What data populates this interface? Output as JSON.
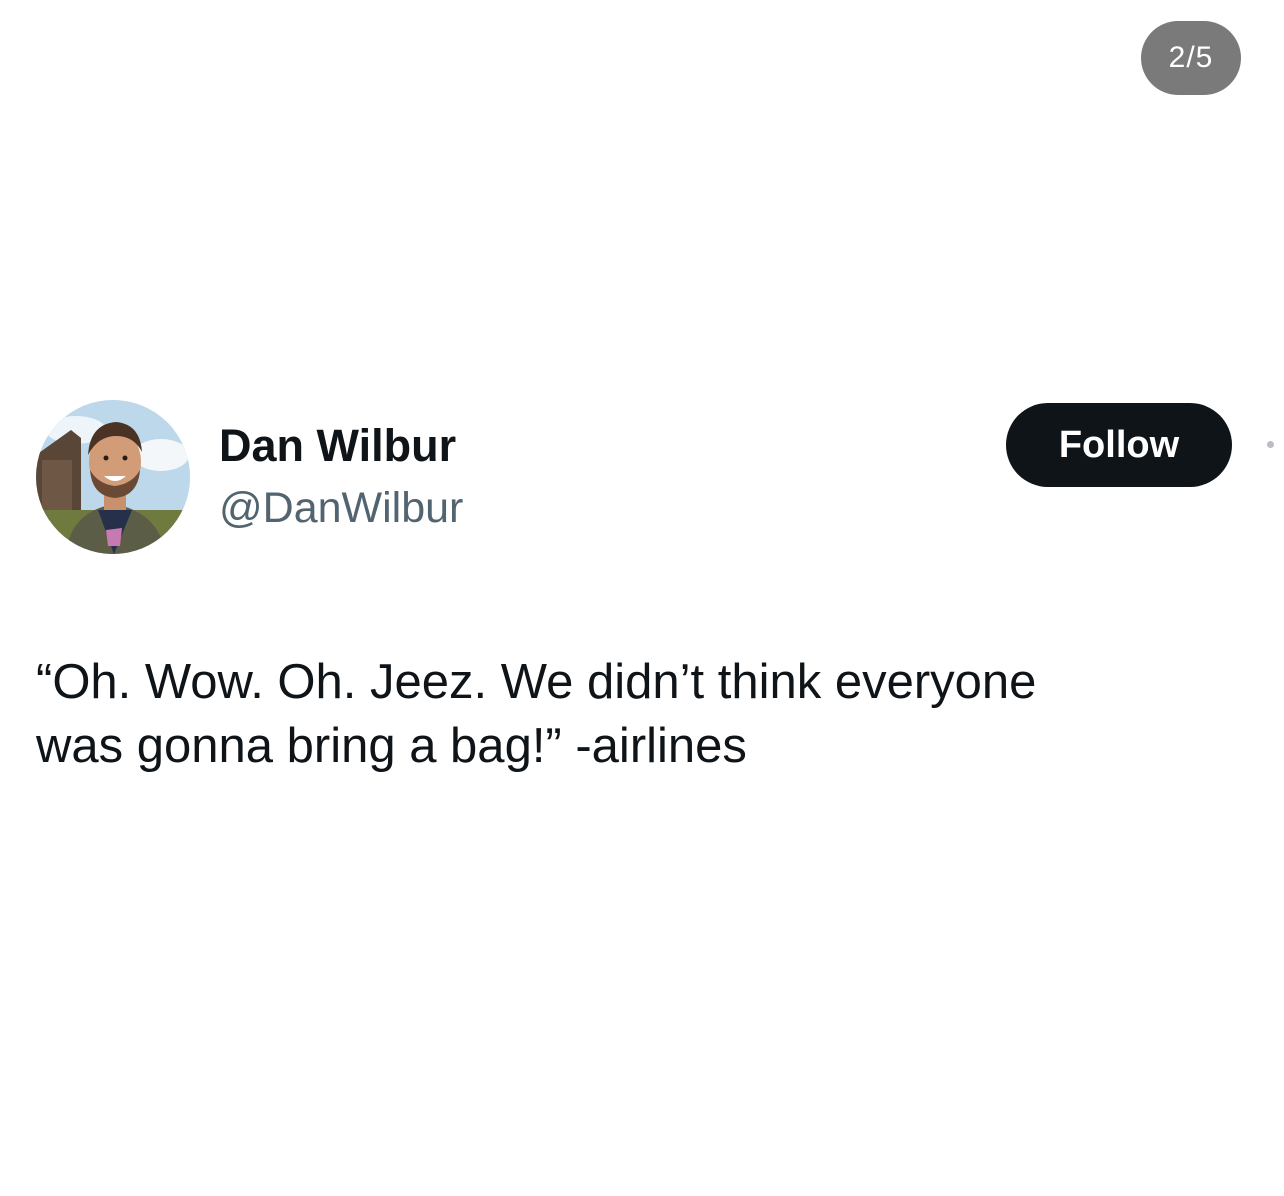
{
  "media_counter": "2/5",
  "tweet": {
    "author": {
      "display_name": "Dan Wilbur",
      "handle": "@DanWilbur",
      "avatar": "avatar-photo"
    },
    "follow_label": "Follow",
    "text": "“Oh. Wow. Oh. Jeez. We didn’t think everyone\nwas gonna bring a bag!” -airlines"
  },
  "icons": {
    "more": "more-dot-icon"
  },
  "colors": {
    "background": "#ffffff",
    "text": "#0f1419",
    "handle": "#536471",
    "follow_button_bg": "#0f1419",
    "follow_button_text": "#ffffff",
    "counter_bg": "#7a7a7a"
  }
}
